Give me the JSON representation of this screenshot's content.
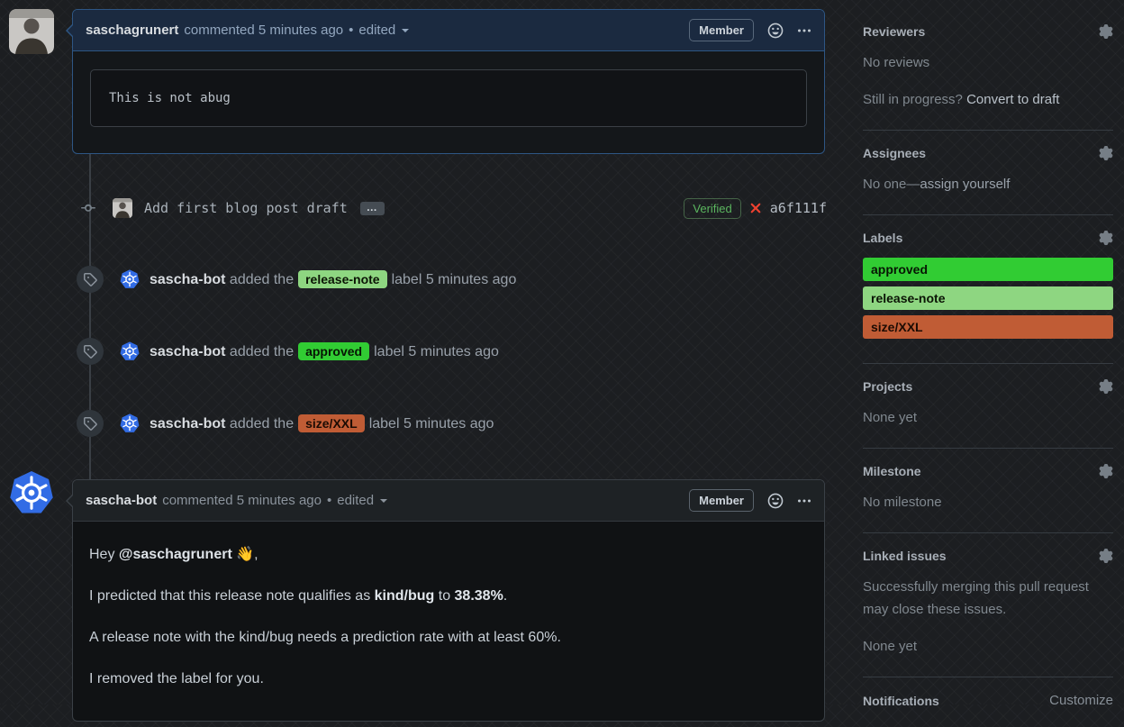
{
  "colors": {
    "accent_blue": "#2e5684",
    "verified_green": "#5bb65f",
    "failed_red": "#ee4130",
    "k8s_blue": "#326ce5"
  },
  "comment_top": {
    "author": "saschagrunert",
    "meta": "commented 5 minutes ago",
    "separator": "•",
    "edited_label": "edited",
    "member_badge": "Member",
    "code_body": "This is not abug"
  },
  "commit": {
    "message": "Add first blog post draft",
    "more_button": "…",
    "verified_badge": "Verified",
    "sha": "a6f111f"
  },
  "events": [
    {
      "actor": "sascha-bot",
      "action": " added the",
      "label": "release-note",
      "label_bg": "#8ed681",
      "label_color": "#0b1405",
      "suffix": "label 5 minutes ago"
    },
    {
      "actor": "sascha-bot",
      "action": " added the",
      "label": "approved",
      "label_bg": "#31cc33",
      "label_color": "#071504",
      "suffix": "label 5 minutes ago"
    },
    {
      "actor": "sascha-bot",
      "action": " added the",
      "label": "size/XXL",
      "label_bg": "#c05c35",
      "label_color": "#1c0b03",
      "suffix": "label 5 minutes ago"
    }
  ],
  "comment_bot": {
    "author": "sascha-bot",
    "meta": "commented 5 minutes ago",
    "separator": "•",
    "edited_label": "edited",
    "member_badge": "Member",
    "p1_prefix": "Hey ",
    "p1_mention": "@saschagrunert",
    "p1_suffix": " 👋,",
    "p2_prefix": "I predicted that this release note qualifies as ",
    "p2_bold1": "kind/bug",
    "p2_mid": " to ",
    "p2_bold2": "38.38%",
    "p2_suffix": ".",
    "p3": "A release note with the kind/bug needs a prediction rate with at least 60%.",
    "p4": "I removed the label for you."
  },
  "sidebar": {
    "reviewers": {
      "title": "Reviewers",
      "empty": "No reviews",
      "hint_prefix": "Still in progress? ",
      "hint_link": "Convert to draft"
    },
    "assignees": {
      "title": "Assignees",
      "empty_prefix": "No one—",
      "empty_link": "assign yourself"
    },
    "labels": {
      "title": "Labels",
      "items": [
        {
          "name": "approved",
          "bg": "#31cc33",
          "color": "#071504"
        },
        {
          "name": "release-note",
          "bg": "#8ed681",
          "color": "#0b1405"
        },
        {
          "name": "size/XXL",
          "bg": "#c05c35",
          "color": "#1c0b03"
        }
      ]
    },
    "projects": {
      "title": "Projects",
      "empty": "None yet"
    },
    "milestone": {
      "title": "Milestone",
      "empty": "No milestone"
    },
    "linked_issues": {
      "title": "Linked issues",
      "description": "Successfully merging this pull request may close these issues.",
      "empty": "None yet"
    },
    "notifications": {
      "title": "Notifications",
      "link": "Customize"
    }
  }
}
